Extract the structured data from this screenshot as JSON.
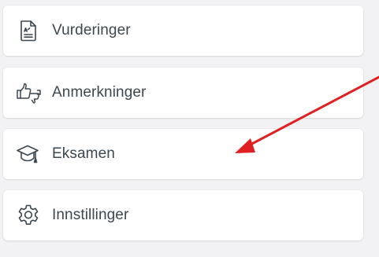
{
  "menu": {
    "items": [
      {
        "label": "Vurderinger",
        "icon": "assessment-document-icon"
      },
      {
        "label": "Anmerkninger",
        "icon": "thumbs-up-down-icon"
      },
      {
        "label": "Eksamen",
        "icon": "graduation-cap-icon"
      },
      {
        "label": "Innstillinger",
        "icon": "gear-icon"
      }
    ]
  },
  "colors": {
    "background": "#f2f2f4",
    "card": "#ffffff",
    "text": "#3d4750",
    "icon_stroke": "#3d4750",
    "arrow": "#e02020"
  }
}
